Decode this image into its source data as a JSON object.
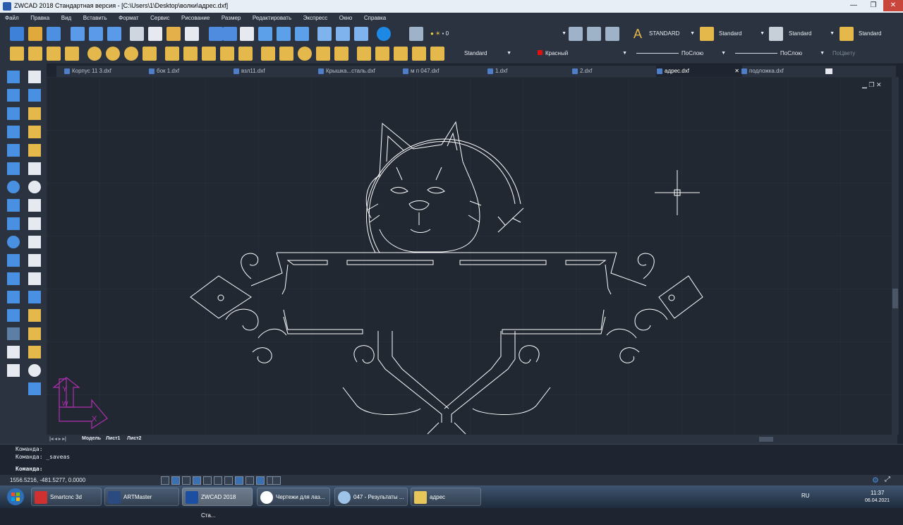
{
  "window": {
    "title": "ZWCAD 2018 Стандартная версия - [C:\\Users\\1\\Desktop\\волки\\адрес.dxf]",
    "minimize": "—",
    "maximize": "❐",
    "close": "✕"
  },
  "menu": [
    "Файл",
    "Правка",
    "Вид",
    "Вставить",
    "Формат",
    "Сервис",
    "Рисование",
    "Размер",
    "Редактировать",
    "Экспресс",
    "Окно",
    "Справка"
  ],
  "toolbar": {
    "layer_value": "0",
    "text_style": "STANDARD",
    "dim_style": "Standard",
    "table_style": "Standard",
    "mleader_style": "Standard",
    "annot_style": "Standard",
    "color": "Красный",
    "color_hex": "#e01010",
    "linetype": "ПоСлою",
    "lineweight": "ПоСлою",
    "plotstyle": "ПоЦвету"
  },
  "doc_tabs": [
    "Корпус 11 3.dxf",
    "бок 1.dxf",
    "взл11.dxf",
    "Крышка...сталь.dxf",
    "м п 047.dxf",
    "1.dxf",
    "2.dxf",
    "адрес.dxf",
    "подложка.dxf"
  ],
  "active_tab": "адрес.dxf",
  "layout_tabs": [
    "Модель",
    "Лист1",
    "Лист2"
  ],
  "ucs": {
    "y_label": "Y",
    "x_label": "X",
    "w_label": "W"
  },
  "command": {
    "line1": "Команда:",
    "line2": "Команда: _saveas",
    "prompt": "Команда:"
  },
  "status": {
    "coords": "1556.5216, -481.5277, 0.0000"
  },
  "taskbar": {
    "items": [
      "Smartcnc 3d",
      "ARTMaster",
      "ZWCAD 2018 Ста...",
      "Чертежи для лаз...",
      "047 - Результаты ...",
      "адрес"
    ],
    "lang": "RU",
    "time": "11:37",
    "date": "06.04.2021"
  },
  "colors": {
    "canvas": "#212832",
    "drawing": "#ffffff",
    "ucs": "#b02eb0",
    "ui": "#2b3340"
  }
}
